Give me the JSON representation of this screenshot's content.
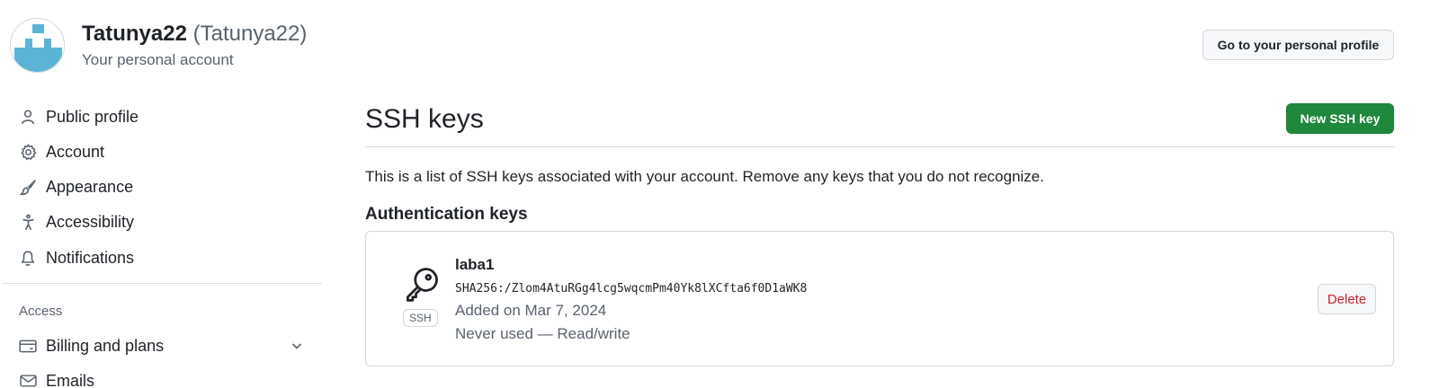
{
  "header": {
    "name": "Tatunya22",
    "login": "(Tatunya22)",
    "subtitle": "Your personal account",
    "profile_button": "Go to your personal profile"
  },
  "sidebar": {
    "items": [
      {
        "label": "Public profile",
        "icon": "person-icon"
      },
      {
        "label": "Account",
        "icon": "gear-icon"
      },
      {
        "label": "Appearance",
        "icon": "paintbrush-icon"
      },
      {
        "label": "Accessibility",
        "icon": "accessibility-icon"
      },
      {
        "label": "Notifications",
        "icon": "bell-icon"
      }
    ],
    "section_access": "Access",
    "access_items": [
      {
        "label": "Billing and plans",
        "icon": "credit-card-icon"
      },
      {
        "label": "Emails",
        "icon": "mail-icon"
      }
    ]
  },
  "main": {
    "title": "SSH keys",
    "new_button": "New SSH key",
    "intro": "This is a list of SSH keys associated with your account. Remove any keys that you do not recognize.",
    "section_title": "Authentication keys",
    "keys": [
      {
        "title": "laba1",
        "type_badge": "SSH",
        "fingerprint": "SHA256:/Zlom4AtuRGg4lcg5wqcmPm40Yk8lXCfta6f0D1aWK8",
        "added": "Added on Mar 7, 2024",
        "usage": "Never used — Read/write",
        "delete_label": "Delete"
      }
    ]
  },
  "colors": {
    "accent_green": "#1f883d",
    "danger_red": "#d1242f",
    "muted_text": "#59636e",
    "avatar_blue": "#5bb3d6"
  }
}
